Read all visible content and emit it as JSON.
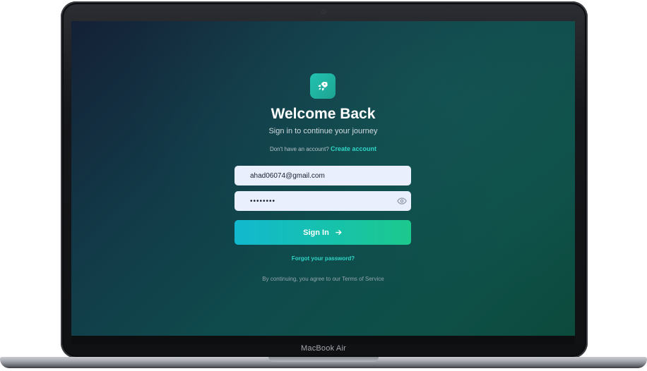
{
  "device": {
    "model_label": "MacBook Air"
  },
  "login": {
    "logo_icon": "rocket-icon",
    "title": "Welcome Back",
    "subtitle": "Sign in to continue your journey",
    "no_account_text": "Don't have an account?",
    "create_account_label": "Create account",
    "email_value": "ahad06074@gmail.com",
    "password_value": "••••••••",
    "password_toggle_icon": "eye-icon",
    "signin_label": "Sign In",
    "signin_icon": "arrow-right-icon",
    "forgot_label": "Forgot your password?",
    "terms_text": "By continuing, you agree to our Terms of Service"
  },
  "colors": {
    "accent": "#2fd6c6",
    "button_start": "#12b8cf",
    "button_end": "#1cc98c",
    "field_bg": "#e9effd"
  }
}
